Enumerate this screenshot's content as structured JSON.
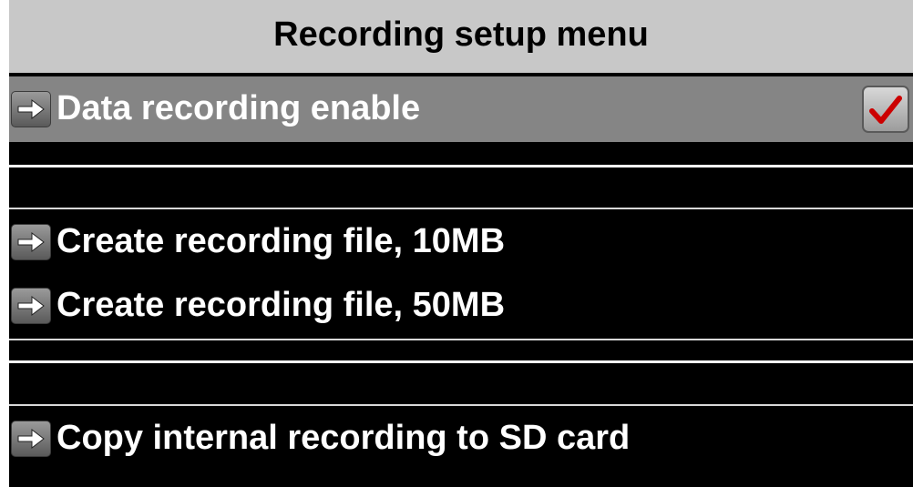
{
  "title": "Recording setup menu",
  "items": [
    {
      "label": "Data recording enable",
      "icon": "arrow-right-icon",
      "checked": true
    },
    {
      "label": "Create recording file, 10MB",
      "icon": "arrow-right-icon"
    },
    {
      "label": "Create recording file, 50MB",
      "icon": "arrow-right-icon"
    },
    {
      "label": "Copy internal recording to SD card",
      "icon": "arrow-right-icon"
    }
  ],
  "colors": {
    "background": "#000000",
    "title_bar": "#c8c8c8",
    "selected_row": "#858585",
    "check_mark": "#cc0000"
  }
}
